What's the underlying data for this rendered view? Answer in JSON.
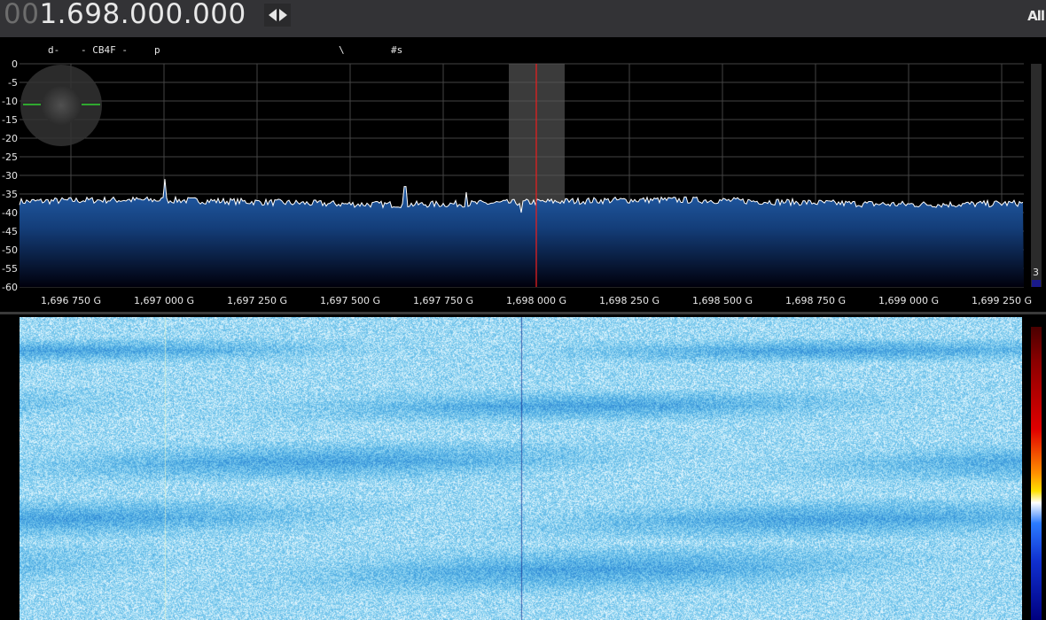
{
  "top_bar": {
    "freq_dim": "00",
    "freq_main": "1.698.000.000",
    "tune_button": "tune-arrows",
    "mode_label": "All"
  },
  "rds": {
    "pi": "d-",
    "callsign": "- CB4F -",
    "pty": "p",
    "rt": "\\",
    "ps": "#s"
  },
  "spectrum": {
    "y_ticks": [
      "0",
      "-5",
      "-10",
      "-15",
      "-20",
      "-25",
      "-30",
      "-35",
      "-40",
      "-45",
      "-50",
      "-55",
      "-60"
    ],
    "x_ticks": [
      "1,696 750 G",
      "1,697 000 G",
      "1,697 250 G",
      "1,697 500 G",
      "1,697 750 G",
      "1,698 000 G",
      "1,698 250 G",
      "1,698 500 G",
      "1,698 750 G",
      "1,699 000 G",
      "1,699 250 G"
    ],
    "level_label": "3",
    "colors": {
      "trace": "#ffffff",
      "grid": "#444444",
      "center_line": "#e02020",
      "fill_top": "#1e5ba8",
      "fill_bottom": "#000010",
      "passband": "#5a5a5a"
    }
  }
}
